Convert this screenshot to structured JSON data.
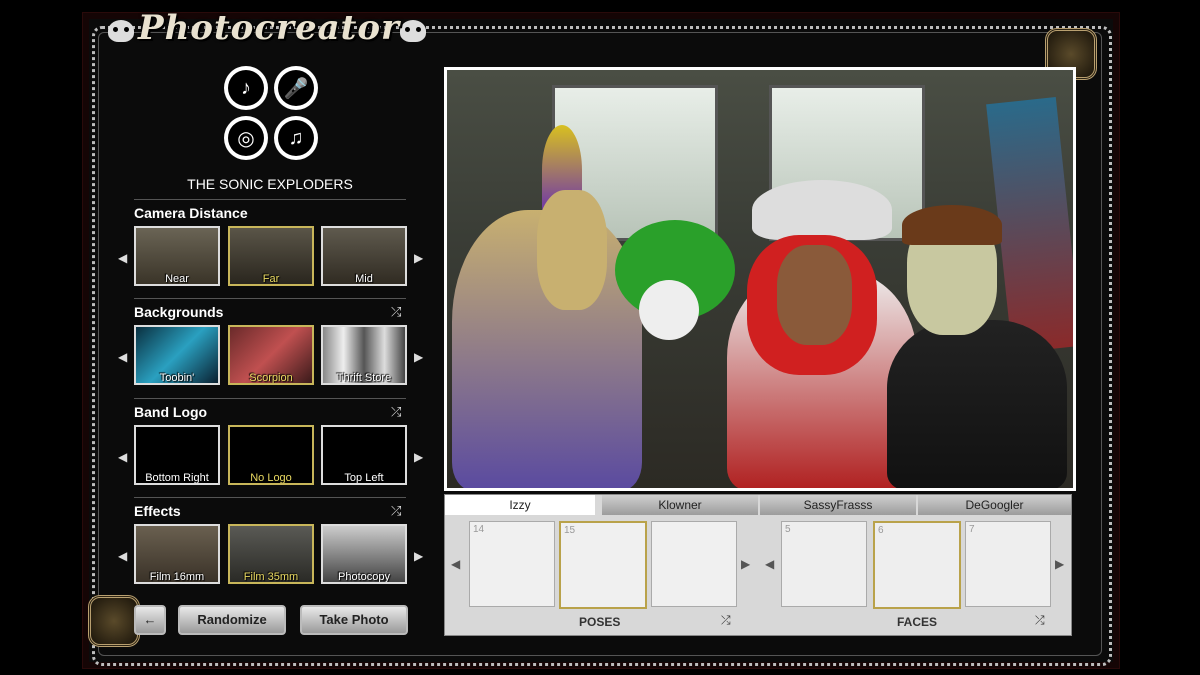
{
  "app": {
    "title": "Photocreator"
  },
  "band": {
    "name": "THE SONIC EXPLODERS",
    "instruments": [
      "guitar-icon",
      "mic-icon",
      "drums-icon",
      "bass-icon"
    ]
  },
  "sections": {
    "camera": {
      "title": "Camera Distance",
      "options": [
        "Near",
        "Far",
        "Mid"
      ],
      "selected": "Far"
    },
    "backgrounds": {
      "title": "Backgrounds",
      "options": [
        "Toobin'",
        "Scorpion",
        "Thrift Store"
      ],
      "selected": "Scorpion"
    },
    "logo": {
      "title": "Band Logo",
      "options": [
        "Bottom Right",
        "No Logo",
        "Top Left"
      ],
      "selected": "No Logo"
    },
    "effects": {
      "title": "Effects",
      "options": [
        "Film 16mm",
        "Film 35mm",
        "Photocopy"
      ],
      "selected": "Film 35mm"
    }
  },
  "buttons": {
    "back": "←",
    "randomize": "Randomize",
    "take_photo": "Take Photo"
  },
  "members": [
    "Izzy",
    "Klowner",
    "SassyFrasss",
    "DeGoogler"
  ],
  "poses": {
    "label": "POSES",
    "numbers": [
      "14",
      "15",
      ""
    ],
    "selected_index": 1
  },
  "faces": {
    "label": "FACES",
    "numbers": [
      "5",
      "6",
      "7"
    ],
    "selected_index": 1
  },
  "colors": {
    "selected_gold": "#c8b65a",
    "frame_bg": "#0b0b0b"
  }
}
